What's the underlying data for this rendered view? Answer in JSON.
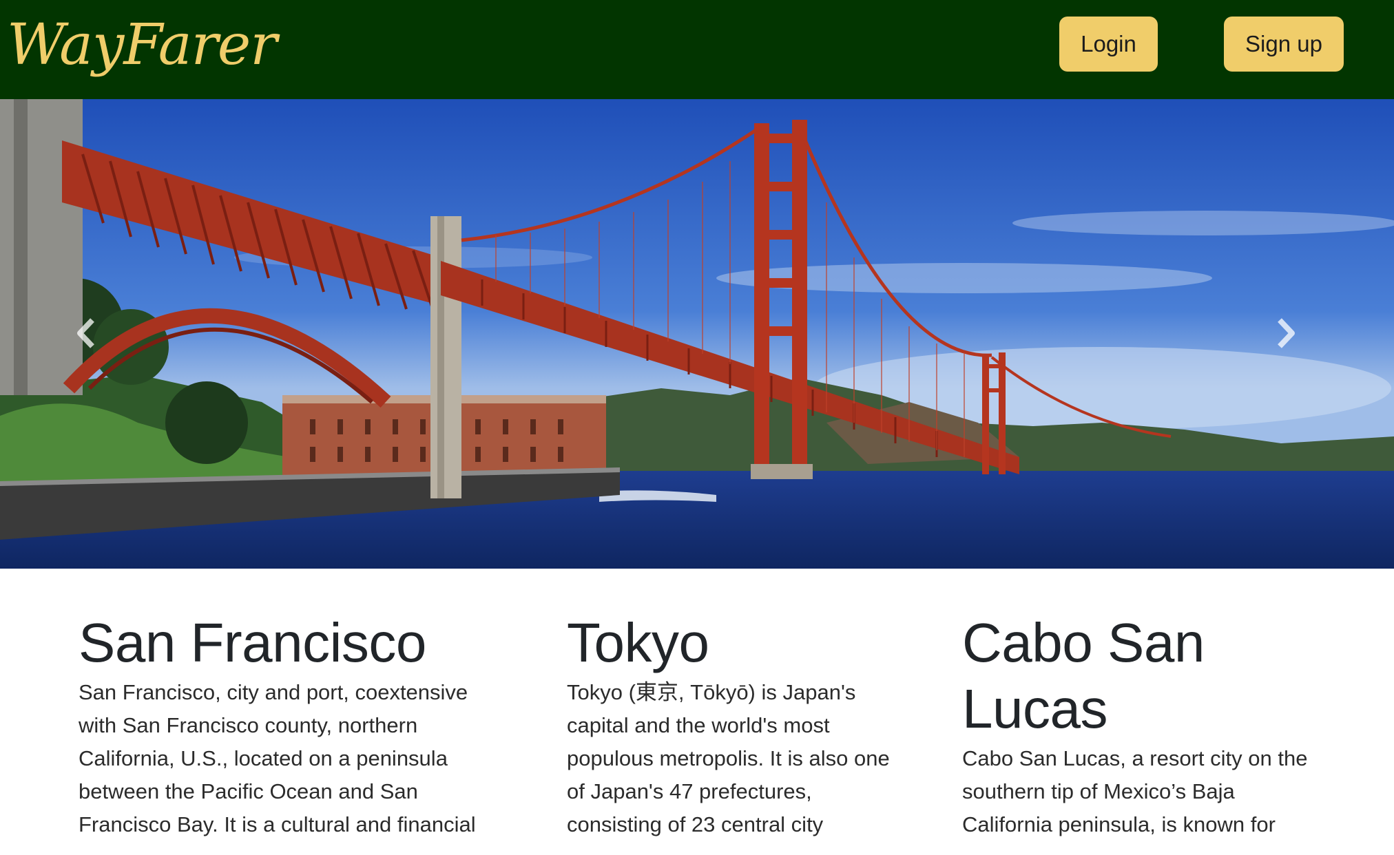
{
  "navbar": {
    "brand": "WayFarer",
    "login_label": "Login",
    "signup_label": "Sign up"
  },
  "carousel": {
    "prev_icon": "chevron-left-icon",
    "next_icon": "chevron-right-icon",
    "slide_subject": "Golden Gate Bridge"
  },
  "cities": [
    {
      "name": "San Francisco",
      "description": "San Francisco, city and port, coextensive with San Francisco county, northern California, U.S., located on a peninsula between the Pacific Ocean and San Francisco Bay. It is a cultural and financial"
    },
    {
      "name": "Tokyo",
      "description": "Tokyo (東京, Tōkyō) is Japan's capital and the world's most populous metropolis. It is also one of Japan's 47 prefectures, consisting of 23 central city"
    },
    {
      "name": "Cabo San Lucas",
      "description": "Cabo San Lucas, a resort city on the southern tip of Mexico’s Baja California peninsula, is known for"
    }
  ],
  "colors": {
    "navbar_bg": "#023500",
    "accent": "#f0cd6a",
    "text": "#212529"
  }
}
